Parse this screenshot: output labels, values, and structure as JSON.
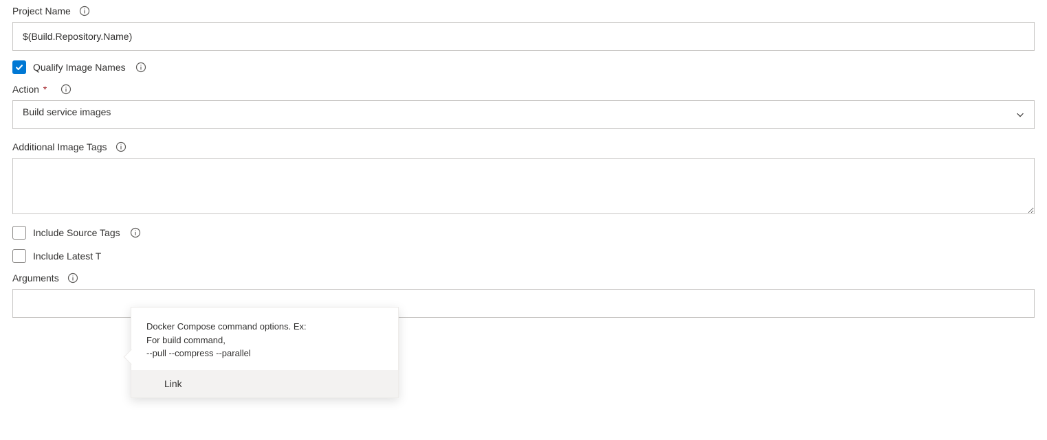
{
  "projectName": {
    "label": "Project Name",
    "value": "$(Build.Repository.Name)"
  },
  "qualifyImageNames": {
    "label": "Qualify Image Names",
    "checked": true
  },
  "action": {
    "label": "Action",
    "value": "Build service images"
  },
  "additionalImageTags": {
    "label": "Additional Image Tags",
    "value": ""
  },
  "includeSourceTags": {
    "label": "Include Source Tags",
    "checked": false
  },
  "includeLatestTag": {
    "label": "Include Latest T",
    "checked": false
  },
  "arguments": {
    "label": "Arguments",
    "value": ""
  },
  "tooltip": {
    "line1": "Docker Compose command options. Ex:",
    "line2": "For build command,",
    "line3": "--pull --compress --parallel",
    "link": "Link"
  }
}
